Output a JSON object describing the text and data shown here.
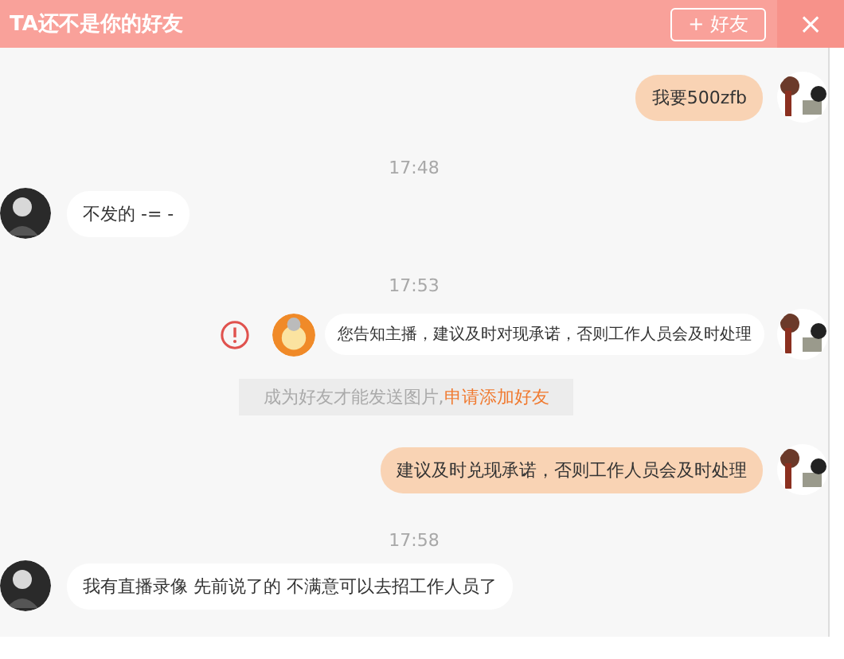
{
  "window": {
    "title": "TA还不是你的好友",
    "add_friend_button": "+ 好友",
    "close": "×"
  },
  "messages": [
    {
      "kind": "out",
      "text": "我要500zfb"
    },
    {
      "kind": "time",
      "text": "17:48"
    },
    {
      "kind": "in",
      "text": "不发的 -= -"
    },
    {
      "kind": "time",
      "text": "17:53"
    },
    {
      "kind": "system",
      "text": "您告知主播，建议及时对现承诺，否则工作人员会及时处理"
    },
    {
      "kind": "notice",
      "text": "成为好友才能发送图片,",
      "link": "申请添加好友"
    },
    {
      "kind": "out",
      "text": "建议及时兑现承诺，否则工作人员会及时处理"
    },
    {
      "kind": "time",
      "text": "17:58"
    },
    {
      "kind": "in",
      "text": "我有直播录像 先前说了的 不满意可以去招工作人员了"
    }
  ]
}
